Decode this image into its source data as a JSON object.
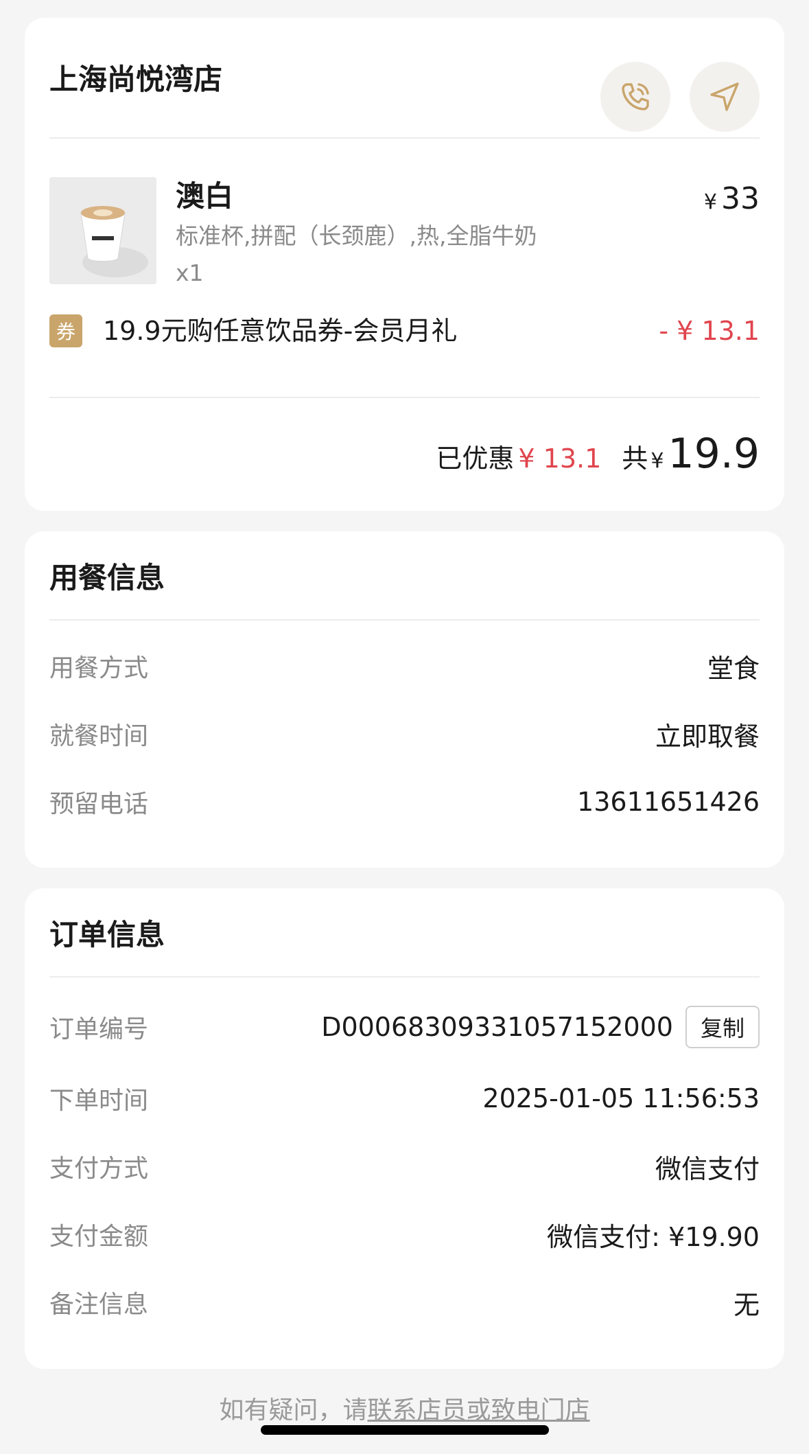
{
  "store": {
    "name": "上海尚悦湾店",
    "call_icon": "phone-icon",
    "nav_icon": "navigation-arrow-icon"
  },
  "item": {
    "name": "澳白",
    "spec": "标准杯,拼配（长颈鹿）,热,全脂牛奶",
    "qty": "x1",
    "currency": "¥",
    "price": "33"
  },
  "coupon": {
    "badge": "券",
    "name": "19.9元购任意饮品券-会员月礼",
    "amount": "- ¥ 13.1"
  },
  "summary": {
    "discount_label": "已优惠",
    "discount_value": "¥ 13.1",
    "total_label": "共",
    "currency": "¥",
    "total_value": "19.9"
  },
  "dining": {
    "title": "用餐信息",
    "rows": [
      {
        "key": "用餐方式",
        "value": "堂食"
      },
      {
        "key": "就餐时间",
        "value": "立即取餐"
      },
      {
        "key": "预留电话",
        "value": "13611651426"
      }
    ]
  },
  "order": {
    "title": "订单信息",
    "rows": [
      {
        "key": "订单编号",
        "value": "D000683093310571520​00"
      },
      {
        "key": "下单时间",
        "value": "2025-01-05 11:56:53"
      },
      {
        "key": "支付方式",
        "value": "微信支付"
      },
      {
        "key": "支付金额",
        "value": "微信支付: ¥19.90"
      },
      {
        "key": "备注信息",
        "value": "无"
      }
    ],
    "copy_label": "复制"
  },
  "footer": {
    "prefix": "如有疑问，请",
    "link": "联系店员或致电门店"
  },
  "colors": {
    "accent_gold": "#c9a56b",
    "discount_red": "#e0454e"
  }
}
